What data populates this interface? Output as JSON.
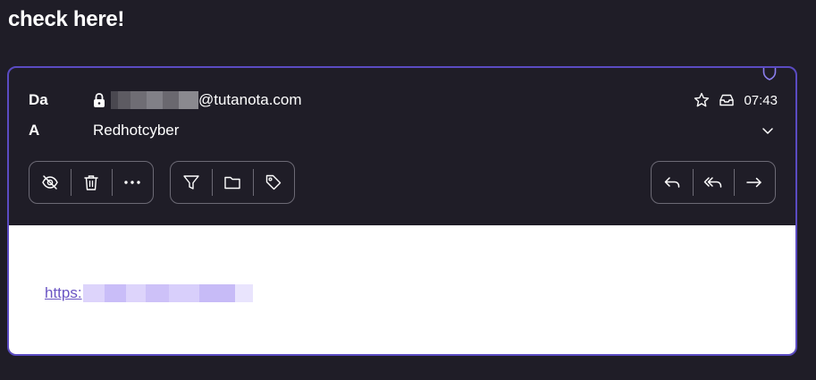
{
  "page": {
    "title": "check here!"
  },
  "mail": {
    "from_label": "Da",
    "from_address_visible": "@tutanota.com",
    "to_label": "A",
    "to_value": "Redhotcyber",
    "time": "07:43",
    "link_prefix": "https:"
  },
  "icons": {
    "shield": "shield-icon",
    "lock": "lock-icon",
    "star": "star-icon",
    "inbox": "inbox-icon",
    "chevron": "chevron-down-icon",
    "hide": "eye-off-icon",
    "trash": "trash-icon",
    "more": "more-icon",
    "filter": "filter-icon",
    "folder": "folder-icon",
    "tag": "tag-icon",
    "reply": "reply-icon",
    "reply_all": "reply-all-icon",
    "forward": "forward-icon"
  },
  "colors": {
    "background": "#1f1d27",
    "accent": "#5a4bc2",
    "link": "#6a55c4",
    "body_bg": "#ffffff"
  }
}
